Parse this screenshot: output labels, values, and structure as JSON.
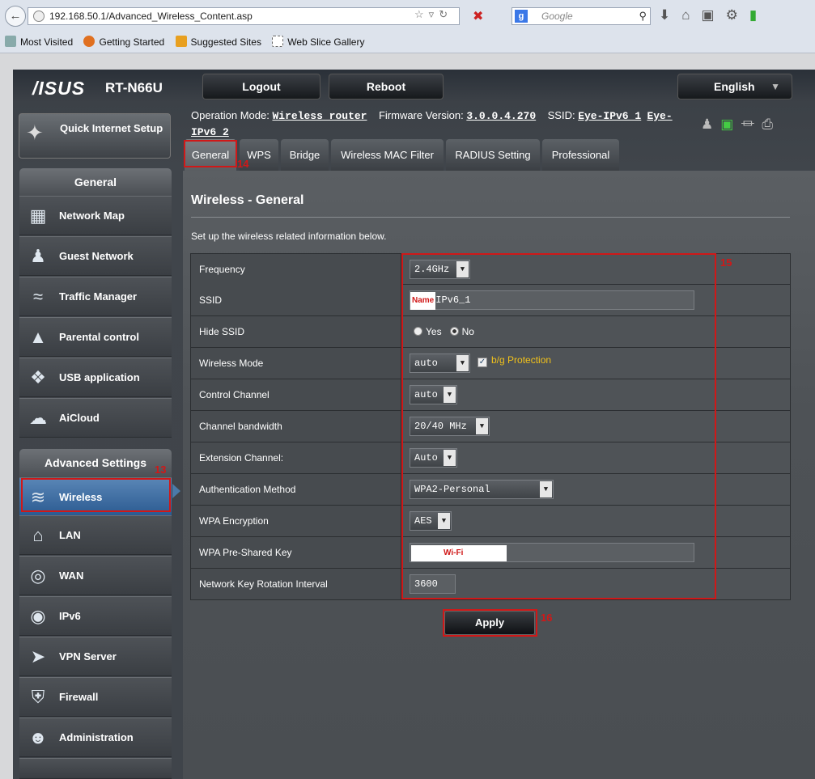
{
  "browser": {
    "url": "192.168.50.1/Advanced_Wireless_Content.asp",
    "search_placeholder": "Google",
    "search_engine_icon": "google-icon",
    "bookmarks": [
      "Most Visited",
      "Getting Started",
      "Suggested Sites",
      "Web Slice Gallery"
    ]
  },
  "header": {
    "brand": "/ISUS",
    "model": "RT-N66U",
    "logout_label": "Logout",
    "reboot_label": "Reboot",
    "language": "English",
    "info": {
      "mode_label": "Operation Mode:",
      "mode_value": "Wireless router",
      "firmware_label": "Firmware Version:",
      "firmware_value": "3.0.0.4.270",
      "ssid_label": "SSID:",
      "ssid_value_1": "Eye-IPv6_1",
      "ssid_value_2a": "Eye-",
      "ssid_value_2b": "IPv6_2"
    }
  },
  "sidebar": {
    "qis_label": "Quick Internet Setup",
    "general_header": "General",
    "general_items": [
      {
        "label": "Network Map",
        "icon": "network-map-icon"
      },
      {
        "label": "Guest Network",
        "icon": "guest-network-icon"
      },
      {
        "label": "Traffic Manager",
        "icon": "traffic-manager-icon"
      },
      {
        "label": "Parental control",
        "icon": "lock-icon"
      },
      {
        "label": "USB application",
        "icon": "puzzle-icon"
      },
      {
        "label": "AiCloud",
        "icon": "cloud-icon"
      }
    ],
    "advanced_header": "Advanced Settings",
    "advanced_items": [
      {
        "label": "Wireless",
        "icon": "wifi-icon"
      },
      {
        "label": "LAN",
        "icon": "home-icon"
      },
      {
        "label": "WAN",
        "icon": "globe-icon"
      },
      {
        "label": "IPv6",
        "icon": "ipv6-icon"
      },
      {
        "label": "VPN Server",
        "icon": "vpn-icon"
      },
      {
        "label": "Firewall",
        "icon": "shield-icon"
      },
      {
        "label": "Administration",
        "icon": "admin-icon"
      }
    ]
  },
  "annotations": {
    "n13": "13",
    "n14": "14",
    "n15": "15",
    "n16": "16"
  },
  "tabs": [
    "General",
    "WPS",
    "Bridge",
    "Wireless MAC Filter",
    "RADIUS Setting",
    "Professional"
  ],
  "main": {
    "title": "Wireless - General",
    "description": "Set up the wireless related information below."
  },
  "form": {
    "frequency": {
      "label": "Frequency",
      "value": "2.4GHz"
    },
    "ssid": {
      "label": "SSID",
      "overlay": "Name",
      "value": "IPv6_1"
    },
    "hide_ssid": {
      "label": "Hide SSID",
      "yes": "Yes",
      "no": "No",
      "selected": "No"
    },
    "wireless_mode": {
      "label": "Wireless Mode",
      "value": "auto",
      "checkbox_label": "b/g Protection",
      "checked": true
    },
    "control_channel": {
      "label": "Control Channel",
      "value": "auto"
    },
    "channel_bandwidth": {
      "label": "Channel bandwidth",
      "value": "20/40 MHz"
    },
    "extension_channel": {
      "label": "Extension Channel:",
      "value": "Auto"
    },
    "auth_method": {
      "label": "Authentication Method",
      "value": "WPA2-Personal"
    },
    "wpa_encryption": {
      "label": "WPA Encryption",
      "value": "AES"
    },
    "psk": {
      "label": "WPA Pre-Shared Key",
      "overlay": "Wi-Fi"
    },
    "key_rotation": {
      "label": "Network Key Rotation Interval",
      "value": "3600"
    }
  },
  "apply_label": "Apply",
  "colors": {
    "annotation_red": "#d01818",
    "active_blue": "#2a5a91",
    "checkbox_text": "#f2c21b"
  }
}
